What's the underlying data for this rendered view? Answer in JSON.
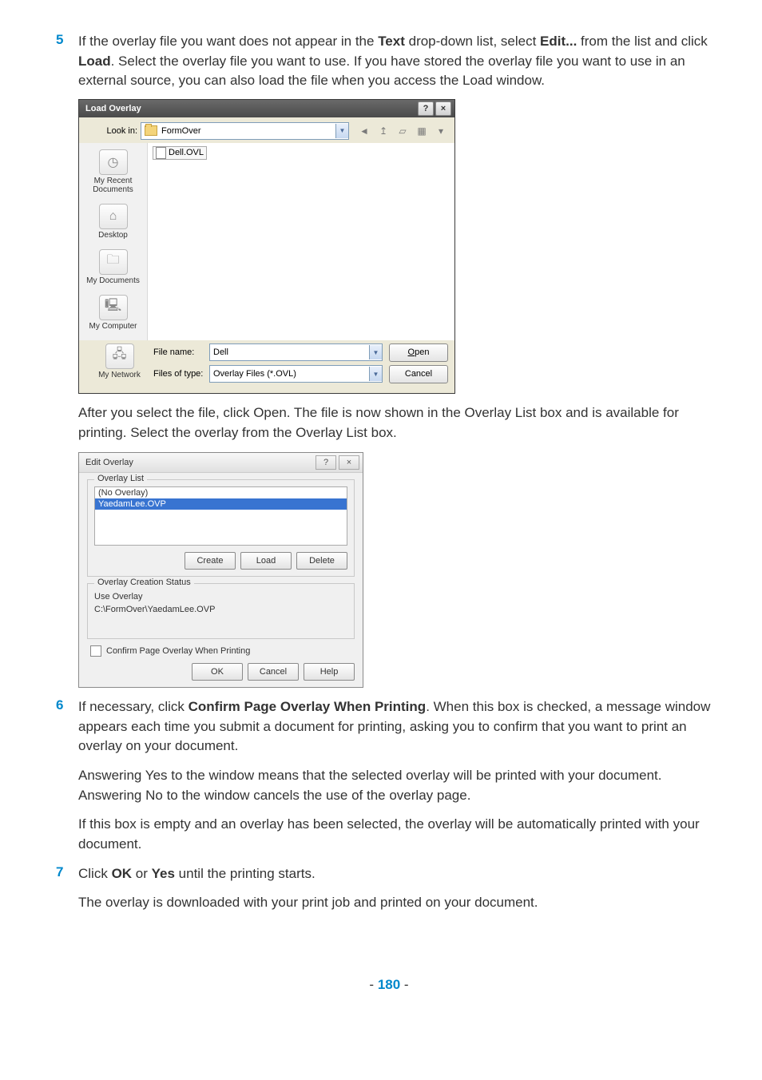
{
  "step5": {
    "num": "5",
    "text_parts": {
      "p1": "If the overlay file you want does not appear in the ",
      "b1": "Text",
      "p2": " drop-down list, select ",
      "b2": "Edit...",
      "p3": " from the list and click ",
      "b3": "Load",
      "p4": ". Select the overlay file you want to use. If you have stored the overlay file you want to use in an external source, you can also load the file when you access the Load window."
    },
    "after": {
      "p1": "After you select the file, click ",
      "b1": "Open",
      "p2": ". The file is now shown in the ",
      "b2": "Overlay List",
      "p3": " box and is available for printing. Select the overlay from the ",
      "b3": "Overlay List",
      "p4": " box."
    }
  },
  "load_dialog": {
    "title": "Load Overlay",
    "help_btn": "?",
    "close_btn": "×",
    "lookin_label": "Look in:",
    "lookin_value": "FormOver",
    "nav_icons": {
      "back": "◄",
      "up": "↥",
      "new": "▱",
      "view": "▦",
      "dd": "▾"
    },
    "places": {
      "recent": "My Recent Documents",
      "desktop": "Desktop",
      "mydocs": "My Documents",
      "mycomp": "My Computer",
      "mynet": "My Network"
    },
    "file_item": "Dell.OVL",
    "filename_label": "File name:",
    "filename_value": "Dell",
    "filetype_label": "Files of type:",
    "filetype_value": "Overlay Files (*.OVL)",
    "open_btn": "Open",
    "cancel_btn": "Cancel"
  },
  "edit_dialog": {
    "title": "Edit Overlay",
    "help_btn": "?",
    "close_btn": "×",
    "group1_label": "Overlay List",
    "list_item1": "(No Overlay)",
    "list_item2": "YaedamLee.OVP",
    "create_btn": "Create",
    "load_btn": "Load",
    "delete_btn": "Delete",
    "group2_label": "Overlay Creation Status",
    "status_line1": "Use Overlay",
    "status_line2": "C:\\FormOver\\YaedamLee.OVP",
    "confirm_label": "Confirm Page Overlay When Printing",
    "ok_btn": "OK",
    "cancel_btn": "Cancel",
    "help_btn2": "Help"
  },
  "step6": {
    "num": "6",
    "text_parts": {
      "p1": "If necessary, click ",
      "b1": "Confirm Page Overlay When Printing",
      "p2": ". When this box is checked, a message window appears each time you submit a document for printing, asking you to confirm that you want to print an overlay on your document."
    },
    "para2": {
      "p1": "Answering ",
      "b1": "Yes",
      "p2": " to the window means that the selected overlay will be printed with your document. Answering ",
      "b2": "No",
      "p3": " to the window cancels the use of the overlay page."
    },
    "para3": "If this box is empty and an overlay has been selected, the overlay will be automatically printed with your document."
  },
  "step7": {
    "num": "7",
    "text_parts": {
      "p1": "Click ",
      "b1": "OK",
      "p2": " or ",
      "b2": "Yes",
      "p3": " until the printing starts."
    },
    "para2": "The overlay is downloaded with your print job and printed on your document."
  },
  "page_number": "180"
}
